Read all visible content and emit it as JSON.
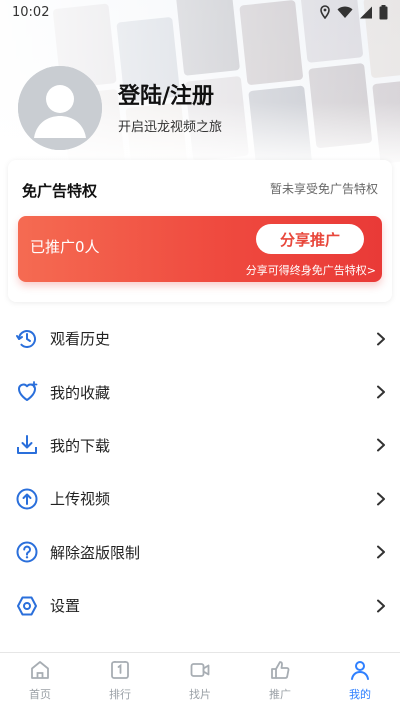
{
  "status_bar": {
    "time": "10:02"
  },
  "profile": {
    "title": "登陆/注册",
    "subtitle": "开启迅龙视频之旅"
  },
  "ad_free": {
    "title": "免广告特权",
    "status": "暂未享受免广告特权",
    "promoted_count": "已推广0人",
    "share_button": "分享推广",
    "hint": "分享可得终身免广告特权>"
  },
  "menu": [
    {
      "label": "观看历史",
      "icon": "history-icon"
    },
    {
      "label": "我的收藏",
      "icon": "heart-icon"
    },
    {
      "label": "我的下载",
      "icon": "download-icon"
    },
    {
      "label": "上传视频",
      "icon": "upload-icon"
    },
    {
      "label": "解除盗版限制",
      "icon": "help-icon"
    },
    {
      "label": "设置",
      "icon": "settings-icon"
    }
  ],
  "bottom_nav": [
    {
      "label": "首页",
      "icon": "home-icon",
      "active": false
    },
    {
      "label": "排行",
      "icon": "ranking-icon",
      "active": false
    },
    {
      "label": "找片",
      "icon": "video-icon",
      "active": false
    },
    {
      "label": "推广",
      "icon": "thumbs-up-icon",
      "active": false
    },
    {
      "label": "我的",
      "icon": "user-icon",
      "active": true
    }
  ],
  "colors": {
    "accent_blue": "#2f80ff",
    "promo_red": "#ef4a3f",
    "icon_blue": "#2a6fdb"
  }
}
